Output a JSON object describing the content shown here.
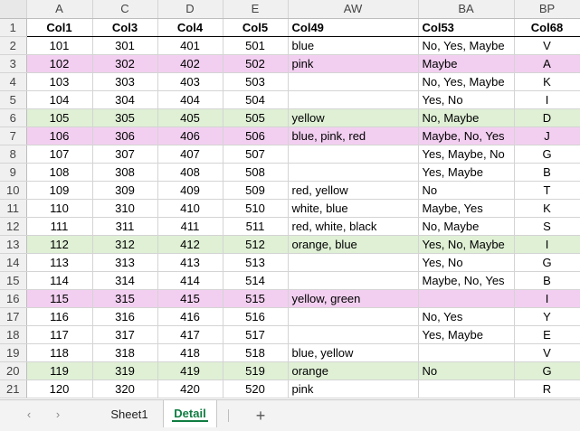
{
  "columns": [
    "A",
    "C",
    "D",
    "E",
    "AW",
    "BA",
    "BP"
  ],
  "rows": [
    {
      "n": "1",
      "style": "header",
      "cells": [
        "Col1",
        "Col3",
        "Col4",
        "Col5",
        "Col49",
        "Col53",
        "Col68"
      ]
    },
    {
      "n": "2",
      "style": "",
      "cells": [
        "101",
        "301",
        "401",
        "501",
        "blue",
        "No, Yes, Maybe",
        "V"
      ]
    },
    {
      "n": "3",
      "style": "pink",
      "cells": [
        "102",
        "302",
        "402",
        "502",
        "pink",
        "Maybe",
        "A"
      ]
    },
    {
      "n": "4",
      "style": "",
      "cells": [
        "103",
        "303",
        "403",
        "503",
        "",
        "No, Yes, Maybe",
        "K"
      ]
    },
    {
      "n": "5",
      "style": "",
      "cells": [
        "104",
        "304",
        "404",
        "504",
        "",
        "Yes, No",
        "I"
      ]
    },
    {
      "n": "6",
      "style": "green",
      "cells": [
        "105",
        "305",
        "405",
        "505",
        "yellow",
        "No, Maybe",
        "D"
      ]
    },
    {
      "n": "7",
      "style": "pink",
      "cells": [
        "106",
        "306",
        "406",
        "506",
        "blue, pink, red",
        "Maybe, No, Yes",
        "J"
      ]
    },
    {
      "n": "8",
      "style": "",
      "cells": [
        "107",
        "307",
        "407",
        "507",
        "",
        "Yes, Maybe, No",
        "G"
      ]
    },
    {
      "n": "9",
      "style": "",
      "cells": [
        "108",
        "308",
        "408",
        "508",
        "",
        "Yes, Maybe",
        "B"
      ]
    },
    {
      "n": "10",
      "style": "",
      "cells": [
        "109",
        "309",
        "409",
        "509",
        "red, yellow",
        "No",
        "T"
      ]
    },
    {
      "n": "11",
      "style": "",
      "cells": [
        "110",
        "310",
        "410",
        "510",
        "white, blue",
        "Maybe, Yes",
        "K"
      ]
    },
    {
      "n": "12",
      "style": "",
      "cells": [
        "111",
        "311",
        "411",
        "511",
        "red, white, black",
        "No, Maybe",
        "S"
      ]
    },
    {
      "n": "13",
      "style": "green",
      "cells": [
        "112",
        "312",
        "412",
        "512",
        "orange, blue",
        "Yes, No, Maybe",
        "I"
      ]
    },
    {
      "n": "14",
      "style": "",
      "cells": [
        "113",
        "313",
        "413",
        "513",
        "",
        "Yes, No",
        "G"
      ]
    },
    {
      "n": "15",
      "style": "",
      "cells": [
        "114",
        "314",
        "414",
        "514",
        "",
        "Maybe, No, Yes",
        "B"
      ]
    },
    {
      "n": "16",
      "style": "pink",
      "cells": [
        "115",
        "315",
        "415",
        "515",
        "yellow, green",
        "",
        "I"
      ]
    },
    {
      "n": "17",
      "style": "",
      "cells": [
        "116",
        "316",
        "416",
        "516",
        "",
        "No, Yes",
        "Y"
      ]
    },
    {
      "n": "18",
      "style": "",
      "cells": [
        "117",
        "317",
        "417",
        "517",
        "",
        "Yes, Maybe",
        "E"
      ]
    },
    {
      "n": "19",
      "style": "",
      "cells": [
        "118",
        "318",
        "418",
        "518",
        "blue, yellow",
        "",
        "V"
      ]
    },
    {
      "n": "20",
      "style": "green",
      "cells": [
        "119",
        "319",
        "419",
        "519",
        "orange",
        "No",
        "G"
      ]
    },
    {
      "n": "21",
      "style": "",
      "cells": [
        "120",
        "320",
        "420",
        "520",
        "pink",
        "",
        "R"
      ]
    }
  ],
  "tabs": {
    "prev_icon": "chevron-left-icon",
    "next_icon": "chevron-right-icon",
    "prev_glyph": "‹",
    "next_glyph": "›",
    "sheet1": "Sheet1",
    "detail": "Detail",
    "add_glyph": "+"
  },
  "colors": {
    "pink_fill": "#f2cff0",
    "green_fill": "#dff0d5",
    "active_tab": "#107c41"
  }
}
